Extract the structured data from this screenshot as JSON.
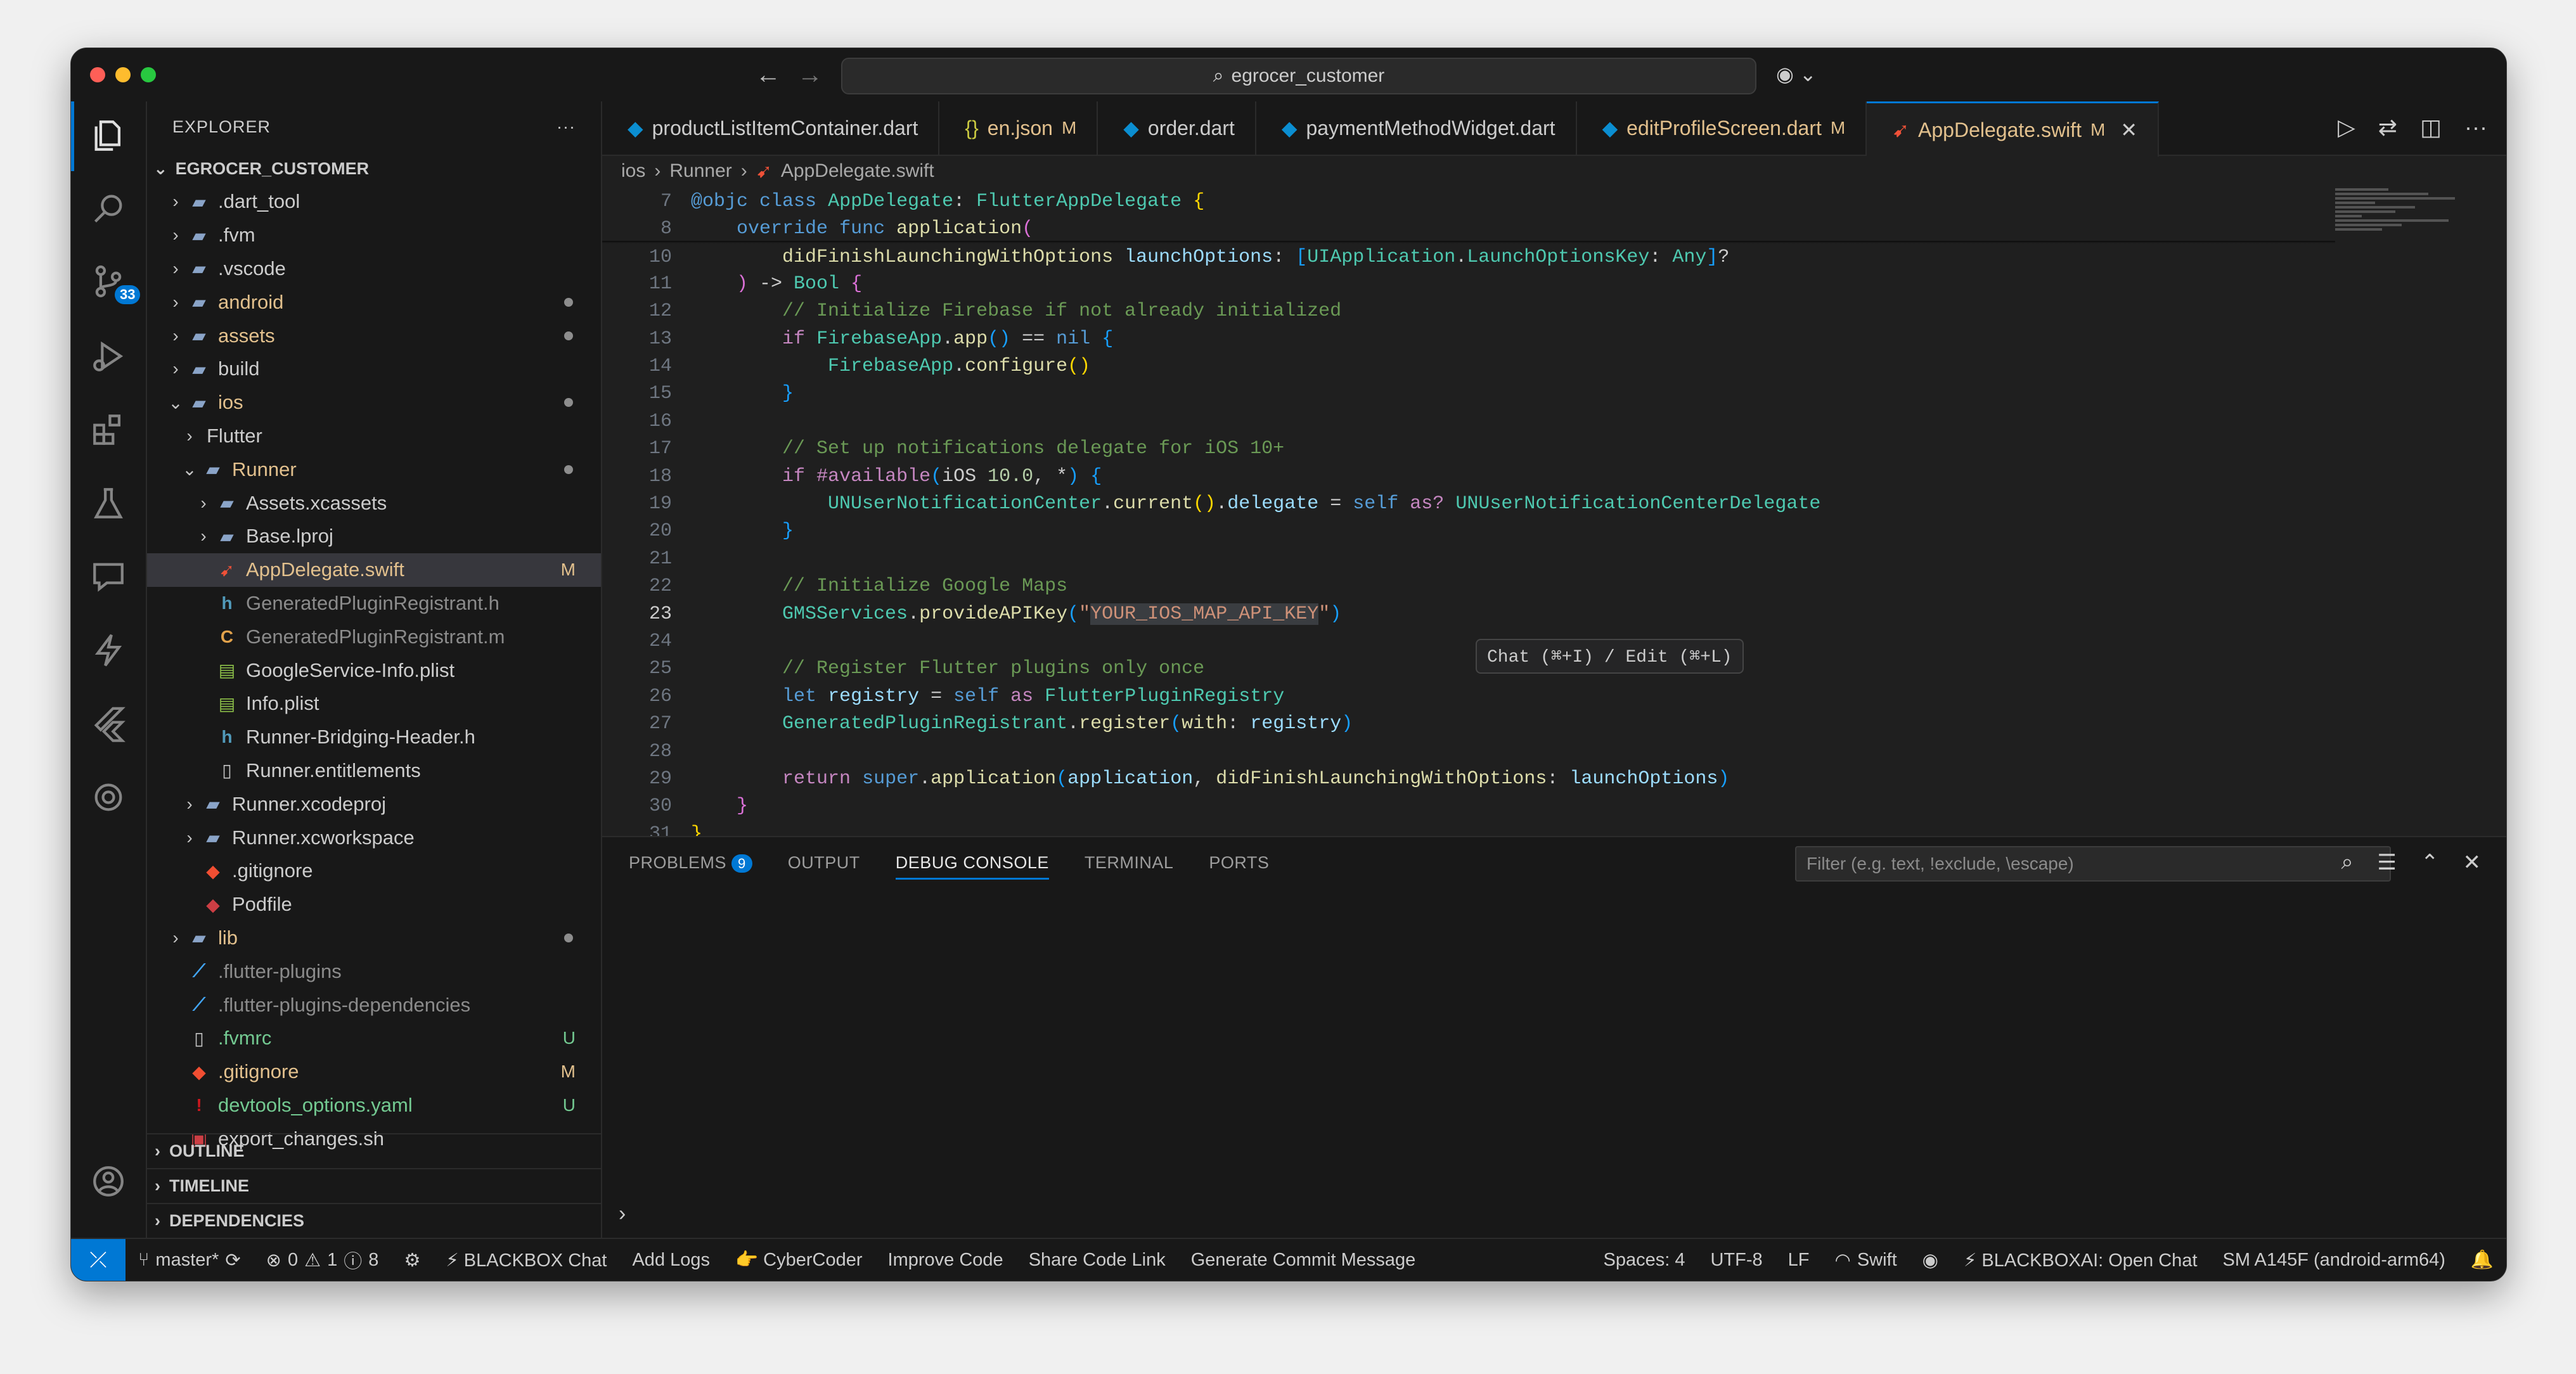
{
  "window": {
    "search_text": "egrocer_customer"
  },
  "activity": {
    "scm_badge": "33"
  },
  "explorer": {
    "title": "EXPLORER",
    "more": "···",
    "root": "EGROCER_CUSTOMER",
    "items": [
      {
        "label": ".dart_tool",
        "indent": 0,
        "chev": "›",
        "icon": "folder-icon",
        "color": "#cccccc"
      },
      {
        "label": ".fvm",
        "indent": 0,
        "chev": "›",
        "icon": "folder-icon",
        "color": "#cccccc"
      },
      {
        "label": ".vscode",
        "indent": 0,
        "chev": "›",
        "icon": "folder-icon",
        "color": "#cccccc"
      },
      {
        "label": "android",
        "indent": 0,
        "chev": "›",
        "icon": "folder-icon",
        "color": "#e2c08d",
        "dot": true
      },
      {
        "label": "assets",
        "indent": 0,
        "chev": "›",
        "icon": "folder-icon",
        "color": "#e2c08d",
        "dot": true
      },
      {
        "label": "build",
        "indent": 0,
        "chev": "›",
        "icon": "folder-icon",
        "color": "#cccccc"
      },
      {
        "label": "ios",
        "indent": 0,
        "chev": "⌄",
        "icon": "folder-icon",
        "color": "#e2c08d",
        "dot": true
      },
      {
        "label": "Flutter",
        "indent": 1,
        "chev": "›",
        "icon": "",
        "color": "#cccccc"
      },
      {
        "label": "Runner",
        "indent": 1,
        "chev": "⌄",
        "icon": "folder-icon",
        "color": "#e2c08d",
        "dot": true
      },
      {
        "label": "Assets.xcassets",
        "indent": 2,
        "chev": "›",
        "icon": "folder-icon",
        "color": "#cccccc"
      },
      {
        "label": "Base.lproj",
        "indent": 2,
        "chev": "›",
        "icon": "folder-icon",
        "color": "#cccccc"
      },
      {
        "label": "AppDelegate.swift",
        "indent": 2,
        "chev": "",
        "icon": "swift-icon",
        "color": "#e2c08d",
        "status": "M",
        "selected": true
      },
      {
        "label": "GeneratedPluginRegistrant.h",
        "indent": 2,
        "chev": "",
        "icon": "header-icon",
        "color": "#8b8b8b"
      },
      {
        "label": "GeneratedPluginRegistrant.m",
        "indent": 2,
        "chev": "",
        "icon": "objc-icon",
        "color": "#8b8b8b"
      },
      {
        "label": "GoogleService-Info.plist",
        "indent": 2,
        "chev": "",
        "icon": "plist-icon",
        "color": "#cccccc"
      },
      {
        "label": "Info.plist",
        "indent": 2,
        "chev": "",
        "icon": "plist-icon",
        "color": "#cccccc"
      },
      {
        "label": "Runner-Bridging-Header.h",
        "indent": 2,
        "chev": "",
        "icon": "header-icon",
        "color": "#cccccc"
      },
      {
        "label": "Runner.entitlements",
        "indent": 2,
        "chev": "",
        "icon": "file-icon",
        "color": "#cccccc"
      },
      {
        "label": "Runner.xcodeproj",
        "indent": 1,
        "chev": "›",
        "icon": "folder-icon",
        "color": "#cccccc"
      },
      {
        "label": "Runner.xcworkspace",
        "indent": 1,
        "chev": "›",
        "icon": "folder-icon",
        "color": "#cccccc"
      },
      {
        "label": ".gitignore",
        "indent": 1,
        "chev": "",
        "icon": "git-icon",
        "color": "#cccccc"
      },
      {
        "label": "Podfile",
        "indent": 1,
        "chev": "",
        "icon": "ruby-icon",
        "color": "#cccccc"
      },
      {
        "label": "lib",
        "indent": 0,
        "chev": "›",
        "icon": "folder-icon",
        "color": "#e2c08d",
        "dot": true
      },
      {
        "label": ".flutter-plugins",
        "indent": 0,
        "chev": "",
        "icon": "flutter-icon",
        "color": "#8b8b8b"
      },
      {
        "label": ".flutter-plugins-dependencies",
        "indent": 0,
        "chev": "",
        "icon": "flutter-icon",
        "color": "#8b8b8b"
      },
      {
        "label": ".fvmrc",
        "indent": 0,
        "chev": "",
        "icon": "file-icon",
        "color": "#73c991",
        "status": "U"
      },
      {
        "label": ".gitignore",
        "indent": 0,
        "chev": "",
        "icon": "git-icon",
        "color": "#e2c08d",
        "status": "M"
      },
      {
        "label": "devtools_options.yaml",
        "indent": 0,
        "chev": "",
        "icon": "yaml-icon",
        "color": "#73c991",
        "status": "U"
      },
      {
        "label": "export_changes.sh",
        "indent": 0,
        "chev": "",
        "icon": "shell-icon",
        "color": "#cccccc"
      }
    ],
    "sections": [
      "OUTLINE",
      "TIMELINE",
      "DEPENDENCIES"
    ]
  },
  "tabs": [
    {
      "label": "productListItemContainer.dart",
      "icon": "dart-icon",
      "mod": "",
      "active": false,
      "color": "#cccccc"
    },
    {
      "label": "en.json",
      "icon": "json-icon",
      "mod": "M",
      "active": false,
      "color": "#e2c08d"
    },
    {
      "label": "order.dart",
      "icon": "dart-icon",
      "mod": "",
      "active": false,
      "color": "#cccccc"
    },
    {
      "label": "paymentMethodWidget.dart",
      "icon": "dart-icon",
      "mod": "",
      "active": false,
      "color": "#cccccc"
    },
    {
      "label": "editProfileScreen.dart",
      "icon": "dart-icon",
      "mod": "M",
      "active": false,
      "color": "#e2c08d"
    },
    {
      "label": "AppDelegate.swift",
      "icon": "swift-icon",
      "mod": "M",
      "active": true,
      "color": "#e2c08d"
    }
  ],
  "breadcrumb": [
    "ios",
    "Runner",
    "AppDelegate.swift"
  ],
  "editor": {
    "inline_chat": "Chat (⌘+I) / Edit (⌘+L)",
    "lines": [
      {
        "n": "7",
        "html": "<span class='kw'>@objc</span> <span class='kw'>class</span> <span class='ty'>AppDelegate</span>: <span class='ty'>FlutterAppDelegate</span> <span class='br'>{</span>"
      },
      {
        "n": "8",
        "html": "    <span class='kw'>override</span> <span class='kw'>func</span> <span class='fn'>application</span><span class='br2'>(</span>"
      },
      {
        "n": "10",
        "html": "        <span class='fn'>didFinishLaunchingWithOptions</span> <span class='pr'>launchOptions</span>: <span class='br3'>[</span><span class='ty'>UIApplication</span>.<span class='ty'>LaunchOptionsKey</span>: <span class='ty'>Any</span><span class='br3'>]</span>?"
      },
      {
        "n": "11",
        "html": "    <span class='br2'>)</span> -&gt; <span class='ty'>Bool</span> <span class='br2'>{</span>"
      },
      {
        "n": "12",
        "html": "        <span class='cm'>// Initialize Firebase if not already initialized</span>"
      },
      {
        "n": "13",
        "html": "        <span class='kw2'>if</span> <span class='ty'>FirebaseApp</span>.<span class='fn'>app</span><span class='br3'>()</span> == <span class='kw'>nil</span> <span class='br3'>{</span>"
      },
      {
        "n": "14",
        "html": "            <span class='ty'>FirebaseApp</span>.<span class='fn'>configure</span><span class='br'>()</span>"
      },
      {
        "n": "15",
        "html": "        <span class='br3'>}</span>"
      },
      {
        "n": "16",
        "html": ""
      },
      {
        "n": "17",
        "html": "        <span class='cm'>// Set up notifications delegate for iOS 10+</span>"
      },
      {
        "n": "18",
        "html": "        <span class='kw2'>if</span> <span class='kw2'>#available</span><span class='br3'>(</span>iOS <span class='nu'>10.0</span>, *<span class='br3'>)</span> <span class='br3'>{</span>"
      },
      {
        "n": "19",
        "html": "            <span class='ty'>UNUserNotificationCenter</span>.<span class='fn'>current</span><span class='br'>()</span>.<span class='pr'>delegate</span> = <span class='kw'>self</span> <span class='kw2'>as?</span> <span class='ty'>UNUserNotificationCenterDelegate</span>"
      },
      {
        "n": "20",
        "html": "        <span class='br3'>}</span>"
      },
      {
        "n": "21",
        "html": ""
      },
      {
        "n": "22",
        "html": "        <span class='cm'>// Initialize Google Maps</span>"
      },
      {
        "n": "23",
        "html": "        <span class='ty'>GMSServices</span>.<span class='fn'>provideAPIKey</span><span class='br3'>(</span><span class='st'>\"<span class='hl'>YOUR_IOS_MAP_API_KEY</span>\"</span><span class='br3'>)</span>",
        "current": true
      },
      {
        "n": "24",
        "html": ""
      },
      {
        "n": "25",
        "html": "        <span class='cm'>// Register Flutter plugins only once</span>"
      },
      {
        "n": "26",
        "html": "        <span class='kw'>let</span> <span class='pr'>registry</span> = <span class='kw'>self</span> <span class='kw2'>as</span> <span class='ty'>FlutterPluginRegistry</span>"
      },
      {
        "n": "27",
        "html": "        <span class='ty'>GeneratedPluginRegistrant</span>.<span class='fn'>register</span><span class='br3'>(</span><span class='fn'>with</span>: <span class='pr'>registry</span><span class='br3'>)</span>"
      },
      {
        "n": "28",
        "html": ""
      },
      {
        "n": "29",
        "html": "        <span class='kw2'>return</span> <span class='kw'>super</span>.<span class='fn'>application</span><span class='br3'>(</span><span class='pr'>application</span>, <span class='fn'>didFinishLaunchingWithOptions</span>: <span class='pr'>launchOptions</span><span class='br3'>)</span>"
      },
      {
        "n": "30",
        "html": "    <span class='br2'>}</span>"
      },
      {
        "n": "31",
        "html": "<span class='br'>}</span>"
      }
    ]
  },
  "panel": {
    "tabs": [
      {
        "label": "PROBLEMS",
        "badge": "9",
        "active": false
      },
      {
        "label": "OUTPUT",
        "active": false
      },
      {
        "label": "DEBUG CONSOLE",
        "active": true
      },
      {
        "label": "TERMINAL",
        "active": false
      },
      {
        "label": "PORTS",
        "active": false
      }
    ],
    "filter_placeholder": "Filter (e.g. text, !exclude, \\escape)",
    "prompt": "›"
  },
  "status": {
    "branch": "master*",
    "errors": "0",
    "warnings": "1",
    "info": "8",
    "left_items": [
      "⚡ BLACKBOX Chat",
      "Add Logs",
      "👉 CyberCoder",
      "Improve Code",
      "Share Code Link",
      "Generate Commit Message"
    ],
    "spaces": "Spaces: 4",
    "encoding": "UTF-8",
    "eol": "LF",
    "language": "Swift",
    "blackbox": "⚡ BLACKBOXAI: Open Chat",
    "device": "SM A145F (android-arm64)"
  },
  "colors": {
    "accent": "#0078d4",
    "modified": "#e2c08d",
    "untracked": "#73c991"
  }
}
